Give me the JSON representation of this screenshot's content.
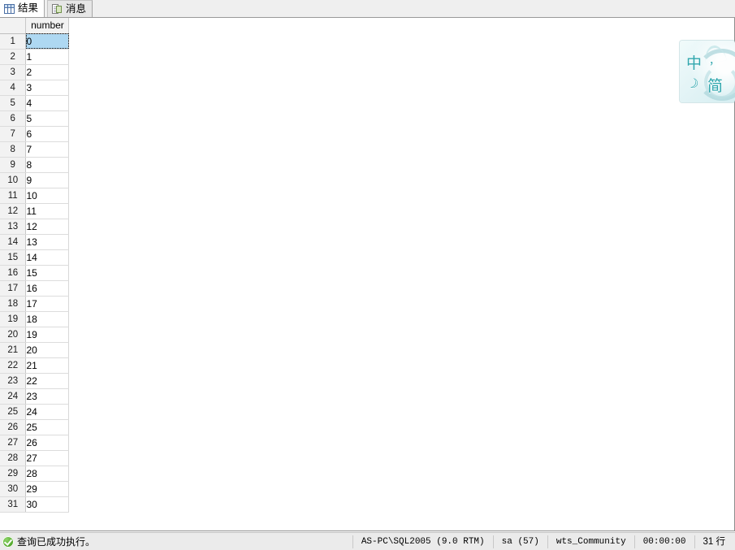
{
  "tabs": [
    {
      "label": "结果",
      "icon": "grid-icon",
      "active": true
    },
    {
      "label": "消息",
      "icon": "document-icon",
      "active": false
    }
  ],
  "grid": {
    "columns": [
      "number"
    ],
    "selected_cell": {
      "row": 1,
      "column": "number",
      "value": "0"
    },
    "rows": [
      {
        "n": "1",
        "number": "0"
      },
      {
        "n": "2",
        "number": "1"
      },
      {
        "n": "3",
        "number": "2"
      },
      {
        "n": "4",
        "number": "3"
      },
      {
        "n": "5",
        "number": "4"
      },
      {
        "n": "6",
        "number": "5"
      },
      {
        "n": "7",
        "number": "6"
      },
      {
        "n": "8",
        "number": "7"
      },
      {
        "n": "9",
        "number": "8"
      },
      {
        "n": "10",
        "number": "9"
      },
      {
        "n": "11",
        "number": "10"
      },
      {
        "n": "12",
        "number": "11"
      },
      {
        "n": "13",
        "number": "12"
      },
      {
        "n": "14",
        "number": "13"
      },
      {
        "n": "15",
        "number": "14"
      },
      {
        "n": "16",
        "number": "15"
      },
      {
        "n": "17",
        "number": "16"
      },
      {
        "n": "18",
        "number": "17"
      },
      {
        "n": "19",
        "number": "18"
      },
      {
        "n": "20",
        "number": "19"
      },
      {
        "n": "21",
        "number": "20"
      },
      {
        "n": "22",
        "number": "21"
      },
      {
        "n": "23",
        "number": "22"
      },
      {
        "n": "24",
        "number": "23"
      },
      {
        "n": "25",
        "number": "24"
      },
      {
        "n": "26",
        "number": "25"
      },
      {
        "n": "27",
        "number": "26"
      },
      {
        "n": "28",
        "number": "27"
      },
      {
        "n": "29",
        "number": "28"
      },
      {
        "n": "30",
        "number": "29"
      },
      {
        "n": "31",
        "number": "30"
      }
    ]
  },
  "ime": {
    "mode": "中",
    "punctuation": "，",
    "moon": "☽",
    "script": "简"
  },
  "statusbar": {
    "message": "查询已成功执行。",
    "server": "AS-PC\\SQL2005 (9.0 RTM)",
    "user": "sa (57)",
    "database": "wts_Community",
    "elapsed": "00:00:00",
    "rowcount": "31 行"
  },
  "colors": {
    "selection": "#aed8f2",
    "header_bg": "#f2f2f2",
    "success": "#55ab2e",
    "ime_accent": "#2fa6ad"
  }
}
